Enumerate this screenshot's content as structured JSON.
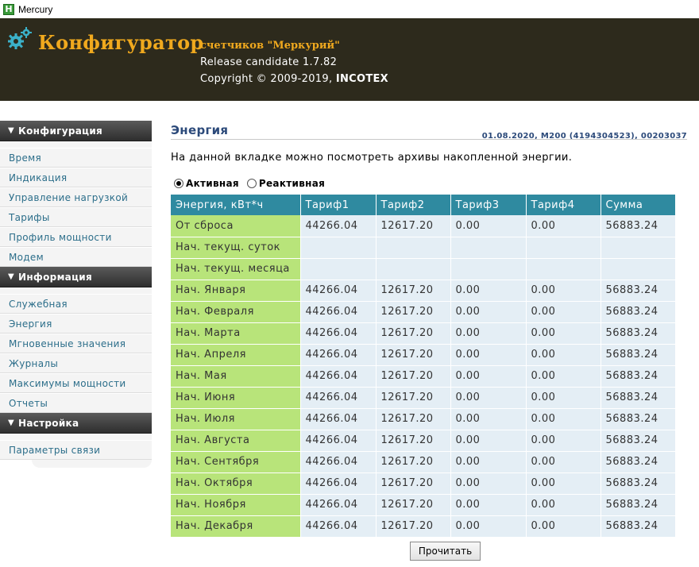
{
  "window": {
    "title": "Mercury",
    "app_icon_letter": "H"
  },
  "header": {
    "brand": "Конфигуратор",
    "subtitle": "счетчиков \"Меркурий\"",
    "release": "Release candidate 1.7.82",
    "copyright_prefix": "Copyright © 2009-2019, ",
    "copyright_company": "INCOTEX"
  },
  "sidebar": {
    "sections": [
      {
        "title": "Конфигурация",
        "items": [
          "Время",
          "Индикация",
          "Управление нагрузкой",
          "Тарифы",
          "Профиль мощности",
          "Модем"
        ]
      },
      {
        "title": "Информация",
        "items": [
          "Служебная",
          "Энергия",
          "Мгновенные значения",
          "Журналы",
          "Максимумы мощности",
          "Отчеты"
        ]
      },
      {
        "title": "Настройка",
        "items": [
          "Параметры связи"
        ]
      }
    ]
  },
  "content": {
    "heading": "Энергия",
    "meta": "01.08.2020, M200 (4194304523), 00203037",
    "description": "На данной вкладке можно посмотреть архивы накопленной энергии."
  },
  "radios": [
    {
      "label": "Активная",
      "checked": true
    },
    {
      "label": "Реактивная",
      "checked": false
    }
  ],
  "table": {
    "headers": [
      "Энергия, кВт*ч",
      "Тариф1",
      "Тариф2",
      "Тариф3",
      "Тариф4",
      "Сумма"
    ],
    "rows": [
      [
        "От сброса",
        "44266.04",
        "12617.20",
        "0.00",
        "0.00",
        "56883.24"
      ],
      [
        "Нач. текущ. суток",
        "",
        "",
        "",
        "",
        ""
      ],
      [
        "Нач. текущ. месяца",
        "",
        "",
        "",
        "",
        ""
      ],
      [
        "Нач. Января",
        "44266.04",
        "12617.20",
        "0.00",
        "0.00",
        "56883.24"
      ],
      [
        "Нач. Февраля",
        "44266.04",
        "12617.20",
        "0.00",
        "0.00",
        "56883.24"
      ],
      [
        "Нач. Марта",
        "44266.04",
        "12617.20",
        "0.00",
        "0.00",
        "56883.24"
      ],
      [
        "Нач. Апреля",
        "44266.04",
        "12617.20",
        "0.00",
        "0.00",
        "56883.24"
      ],
      [
        "Нач. Мая",
        "44266.04",
        "12617.20",
        "0.00",
        "0.00",
        "56883.24"
      ],
      [
        "Нач. Июня",
        "44266.04",
        "12617.20",
        "0.00",
        "0.00",
        "56883.24"
      ],
      [
        "Нач. Июля",
        "44266.04",
        "12617.20",
        "0.00",
        "0.00",
        "56883.24"
      ],
      [
        "Нач. Августа",
        "44266.04",
        "12617.20",
        "0.00",
        "0.00",
        "56883.24"
      ],
      [
        "Нач. Сентября",
        "44266.04",
        "12617.20",
        "0.00",
        "0.00",
        "56883.24"
      ],
      [
        "Нач. Октября",
        "44266.04",
        "12617.20",
        "0.00",
        "0.00",
        "56883.24"
      ],
      [
        "Нач. Ноября",
        "44266.04",
        "12617.20",
        "0.00",
        "0.00",
        "56883.24"
      ],
      [
        "Нач. Декабря",
        "44266.04",
        "12617.20",
        "0.00",
        "0.00",
        "56883.24"
      ]
    ]
  },
  "actions": {
    "read_button": "Прочитать"
  },
  "colors": {
    "header_bg": "#2d2a1c",
    "brand": "#f0a91e",
    "table_header": "#2f8aa0",
    "label_cell": "#b8e47a",
    "data_cell": "#e4eef5",
    "link": "#2c6e8a"
  }
}
